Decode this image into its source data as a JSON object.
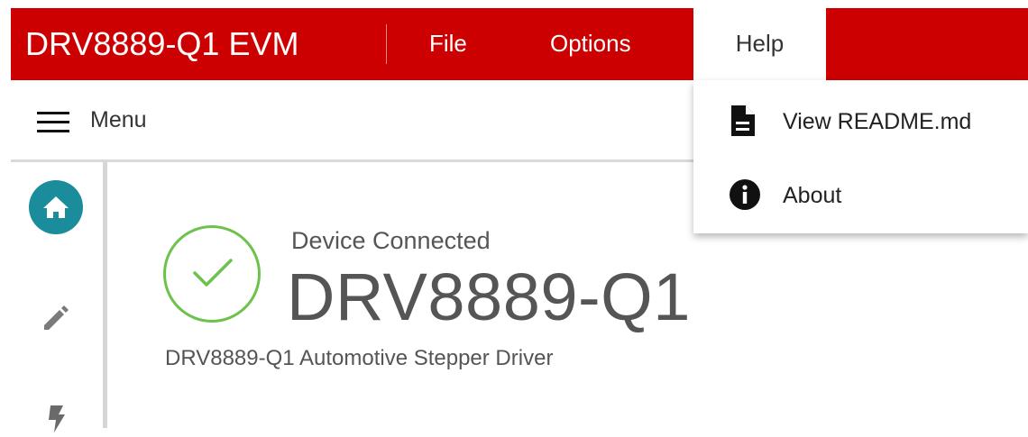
{
  "header": {
    "app_title": "DRV8889-Q1 EVM",
    "menu": {
      "file": "File",
      "options": "Options",
      "help": "Help"
    },
    "brand_color": "#cc0000"
  },
  "toolbar": {
    "menu_label": "Menu",
    "menu_icon": "hamburger-icon"
  },
  "sidebar": {
    "items": [
      {
        "icon": "home-icon",
        "active": true,
        "accent": "#1a8c9b"
      },
      {
        "icon": "pencil-icon",
        "active": false
      },
      {
        "icon": "bolt-icon",
        "active": false
      }
    ]
  },
  "main": {
    "status_text": "Device Connected",
    "device_name": "DRV8889-Q1",
    "device_description": "DRV8889-Q1 Automotive Stepper Driver",
    "status_icon": "check-circle-icon",
    "status_color": "#6cc24a"
  },
  "help_menu": {
    "items": [
      {
        "label": "View README.md",
        "icon": "document-icon"
      },
      {
        "label": "About",
        "icon": "info-icon"
      }
    ]
  }
}
